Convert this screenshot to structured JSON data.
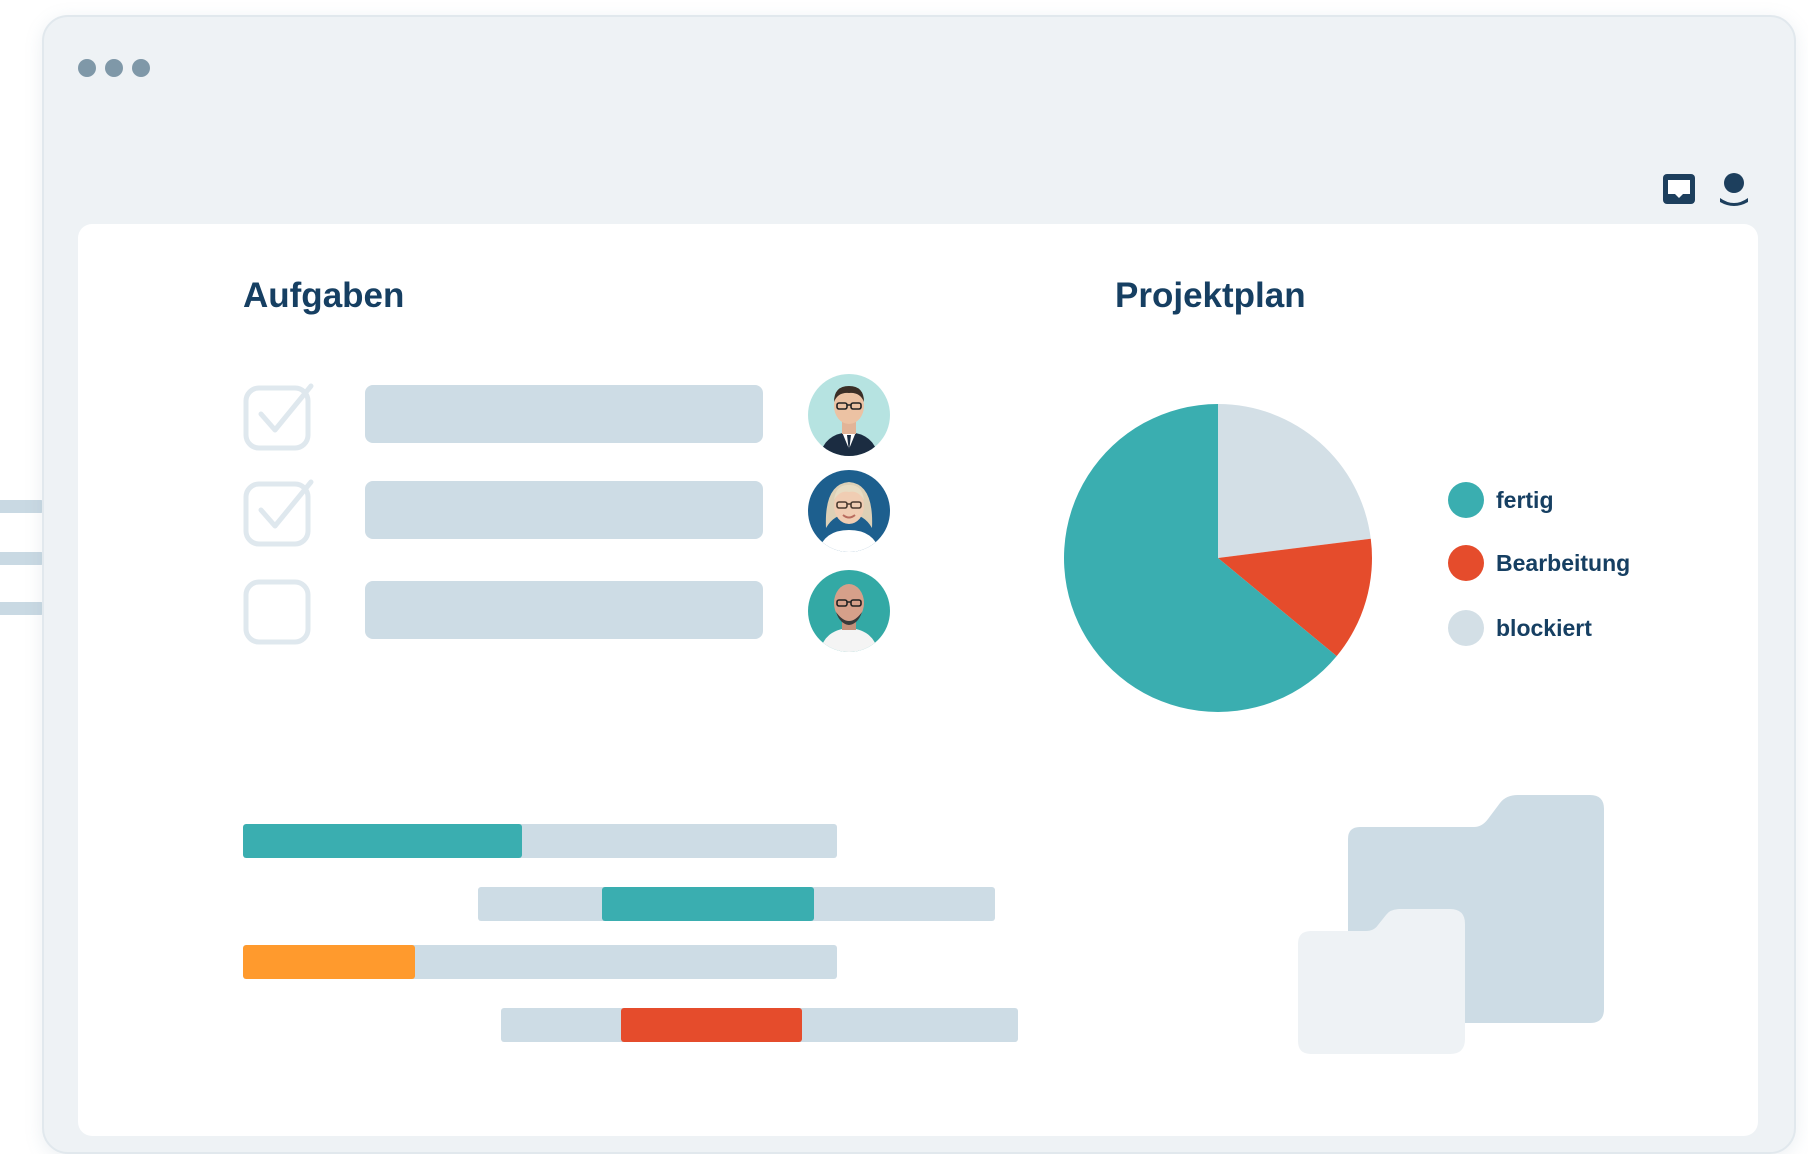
{
  "window": {
    "dots": [
      "dot",
      "dot",
      "dot"
    ],
    "top_icons": [
      "inbox-icon",
      "user-icon"
    ]
  },
  "tasks": {
    "title": "Aufgaben",
    "items": [
      {
        "checked": true,
        "avatar": "avatar-man-glasses"
      },
      {
        "checked": true,
        "avatar": "avatar-woman-glasses"
      },
      {
        "checked": false,
        "avatar": "avatar-man-bald"
      }
    ]
  },
  "gantt": {
    "bars": [
      {
        "progress": 0.47,
        "color": "#3aaeb0"
      },
      {
        "progress": 0.41,
        "color": "#3aaeb0"
      },
      {
        "progress": 0.29,
        "color": "#ff9a2d"
      },
      {
        "progress": 0.35,
        "color": "#e54c2c"
      }
    ]
  },
  "project": {
    "title": "Projektplan",
    "legend": [
      {
        "label": "fertig",
        "color": "#3aaeb0"
      },
      {
        "label": "Bearbeitung",
        "color": "#e54c2c"
      },
      {
        "label": "blockiert",
        "color": "#d3dfe6"
      }
    ]
  },
  "chart_data": {
    "type": "pie",
    "categories": [
      "fertig",
      "Bearbeitung",
      "blockiert"
    ],
    "values": [
      64,
      13,
      23
    ],
    "colors": [
      "#3aaeb0",
      "#e54c2c",
      "#d3dfe6"
    ],
    "legend_position": "right"
  }
}
